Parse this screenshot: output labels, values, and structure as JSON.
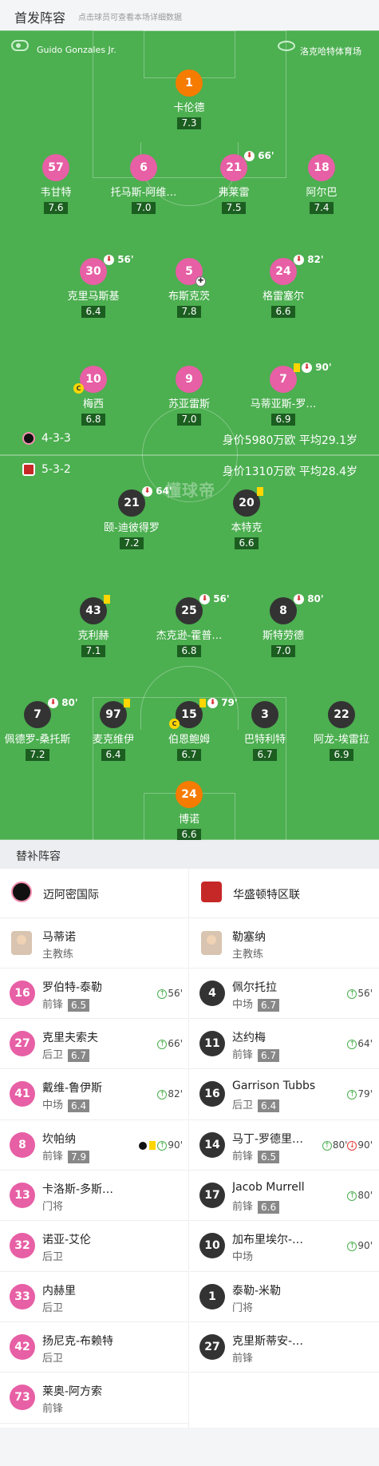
{
  "header": {
    "title": "首发阵容",
    "subtitle": "点击球员可查看本场详细数据"
  },
  "pitch": {
    "referee": "Guido Gonzales Jr.",
    "stadium": "洛克哈特体育场",
    "watermark": "懂球帝",
    "home_formation": "4-3-3",
    "home_value": "身价5980万欧 平均29.1岁",
    "away_formation": "5-3-2",
    "away_value": "身价1310万欧 平均28.4岁",
    "players": [
      {
        "num": "1",
        "name": "卡伦德",
        "rating": "7.3",
        "color": "orange"
      },
      {
        "num": "57",
        "name": "韦甘特",
        "rating": "7.6",
        "color": "pink"
      },
      {
        "num": "6",
        "name": "托马斯-阿维…",
        "rating": "7.0",
        "color": "pink"
      },
      {
        "num": "21",
        "name": "弗莱雷",
        "rating": "7.5",
        "color": "pink",
        "event": "66'"
      },
      {
        "num": "18",
        "name": "阿尔巴",
        "rating": "7.4",
        "color": "pink"
      },
      {
        "num": "30",
        "name": "克里马斯基",
        "rating": "6.4",
        "color": "pink",
        "event": "56'"
      },
      {
        "num": "5",
        "name": "布斯克茨",
        "rating": "7.8",
        "color": "pink"
      },
      {
        "num": "24",
        "name": "格雷塞尔",
        "rating": "6.6",
        "color": "pink",
        "event": "82'"
      },
      {
        "num": "10",
        "name": "梅西",
        "rating": "6.8",
        "color": "pink"
      },
      {
        "num": "9",
        "name": "苏亚雷斯",
        "rating": "7.0",
        "color": "pink"
      },
      {
        "num": "7",
        "name": "马蒂亚斯-罗…",
        "rating": "6.9",
        "color": "pink",
        "event": "90'"
      },
      {
        "num": "21",
        "name": "颐-迪彼得罗",
        "rating": "7.2",
        "color": "dark",
        "event": "64'"
      },
      {
        "num": "20",
        "name": "本特克",
        "rating": "6.6",
        "color": "dark"
      },
      {
        "num": "43",
        "name": "克利赫",
        "rating": "7.1",
        "color": "dark"
      },
      {
        "num": "25",
        "name": "杰克逊-霍普…",
        "rating": "6.8",
        "color": "dark",
        "event": "56'"
      },
      {
        "num": "8",
        "name": "斯特劳德",
        "rating": "7.0",
        "color": "dark",
        "event": "80'"
      },
      {
        "num": "7",
        "name": "佩德罗-桑托斯",
        "rating": "7.2",
        "color": "dark",
        "event": "80'"
      },
      {
        "num": "97",
        "name": "麦克维伊",
        "rating": "6.4",
        "color": "dark"
      },
      {
        "num": "15",
        "name": "伯恩鲍姆",
        "rating": "6.7",
        "color": "dark",
        "event": "79'"
      },
      {
        "num": "3",
        "name": "巴特利特",
        "rating": "6.7",
        "color": "dark"
      },
      {
        "num": "22",
        "name": "阿龙-埃雷拉",
        "rating": "6.9",
        "color": "dark"
      },
      {
        "num": "24",
        "name": "博诺",
        "rating": "6.6",
        "color": "orange"
      }
    ],
    "captain_mark": "C"
  },
  "subs": {
    "title": "替补阵容",
    "home": {
      "team": "迈阿密国际",
      "coach": "马蒂诺",
      "coach_role": "主教练",
      "list": [
        {
          "num": "16",
          "name": "罗伯特-泰勒",
          "pos": "前锋",
          "rating": "6.5",
          "event": "56'"
        },
        {
          "num": "27",
          "name": "克里夫索夫",
          "pos": "后卫",
          "rating": "6.7",
          "event": "66'"
        },
        {
          "num": "41",
          "name": "戴维-鲁伊斯",
          "pos": "中场",
          "rating": "6.4",
          "event": "82'"
        },
        {
          "num": "8",
          "name": "坎帕纳",
          "pos": "前锋",
          "rating": "7.9",
          "event": "90'"
        },
        {
          "num": "13",
          "name": "卡洛斯-多斯…",
          "pos": "门将",
          "rating": "",
          "event": ""
        },
        {
          "num": "32",
          "name": "诺亚-艾伦",
          "pos": "后卫",
          "rating": "",
          "event": ""
        },
        {
          "num": "33",
          "name": "内赫里",
          "pos": "后卫",
          "rating": "",
          "event": ""
        },
        {
          "num": "42",
          "name": "扬尼克-布赖特",
          "pos": "后卫",
          "rating": "",
          "event": ""
        },
        {
          "num": "73",
          "name": "莱奥-阿方索",
          "pos": "前锋",
          "rating": "",
          "event": ""
        }
      ]
    },
    "away": {
      "team": "华盛顿特区联",
      "coach": "勒塞纳",
      "coach_role": "主教练",
      "list": [
        {
          "num": "4",
          "name": "佩尔托拉",
          "pos": "中场",
          "rating": "6.7",
          "event": "56'"
        },
        {
          "num": "11",
          "name": "达约梅",
          "pos": "前锋",
          "rating": "6.7",
          "event": "64'"
        },
        {
          "num": "16",
          "name": "Garrison Tubbs",
          "pos": "后卫",
          "rating": "6.4",
          "event": "79'"
        },
        {
          "num": "14",
          "name": "马丁-罗德里…",
          "pos": "前锋",
          "rating": "6.5",
          "event": "80'",
          "event2": "90'"
        },
        {
          "num": "17",
          "name": "Jacob Murrell",
          "pos": "前锋",
          "rating": "6.6",
          "event": "80'"
        },
        {
          "num": "10",
          "name": "加布里埃尔-…",
          "pos": "中场",
          "rating": "",
          "event": "90'"
        },
        {
          "num": "1",
          "name": "泰勒-米勒",
          "pos": "门将",
          "rating": "",
          "event": ""
        },
        {
          "num": "27",
          "name": "克里斯蒂安-…",
          "pos": "前锋",
          "rating": "",
          "event": ""
        }
      ]
    }
  }
}
